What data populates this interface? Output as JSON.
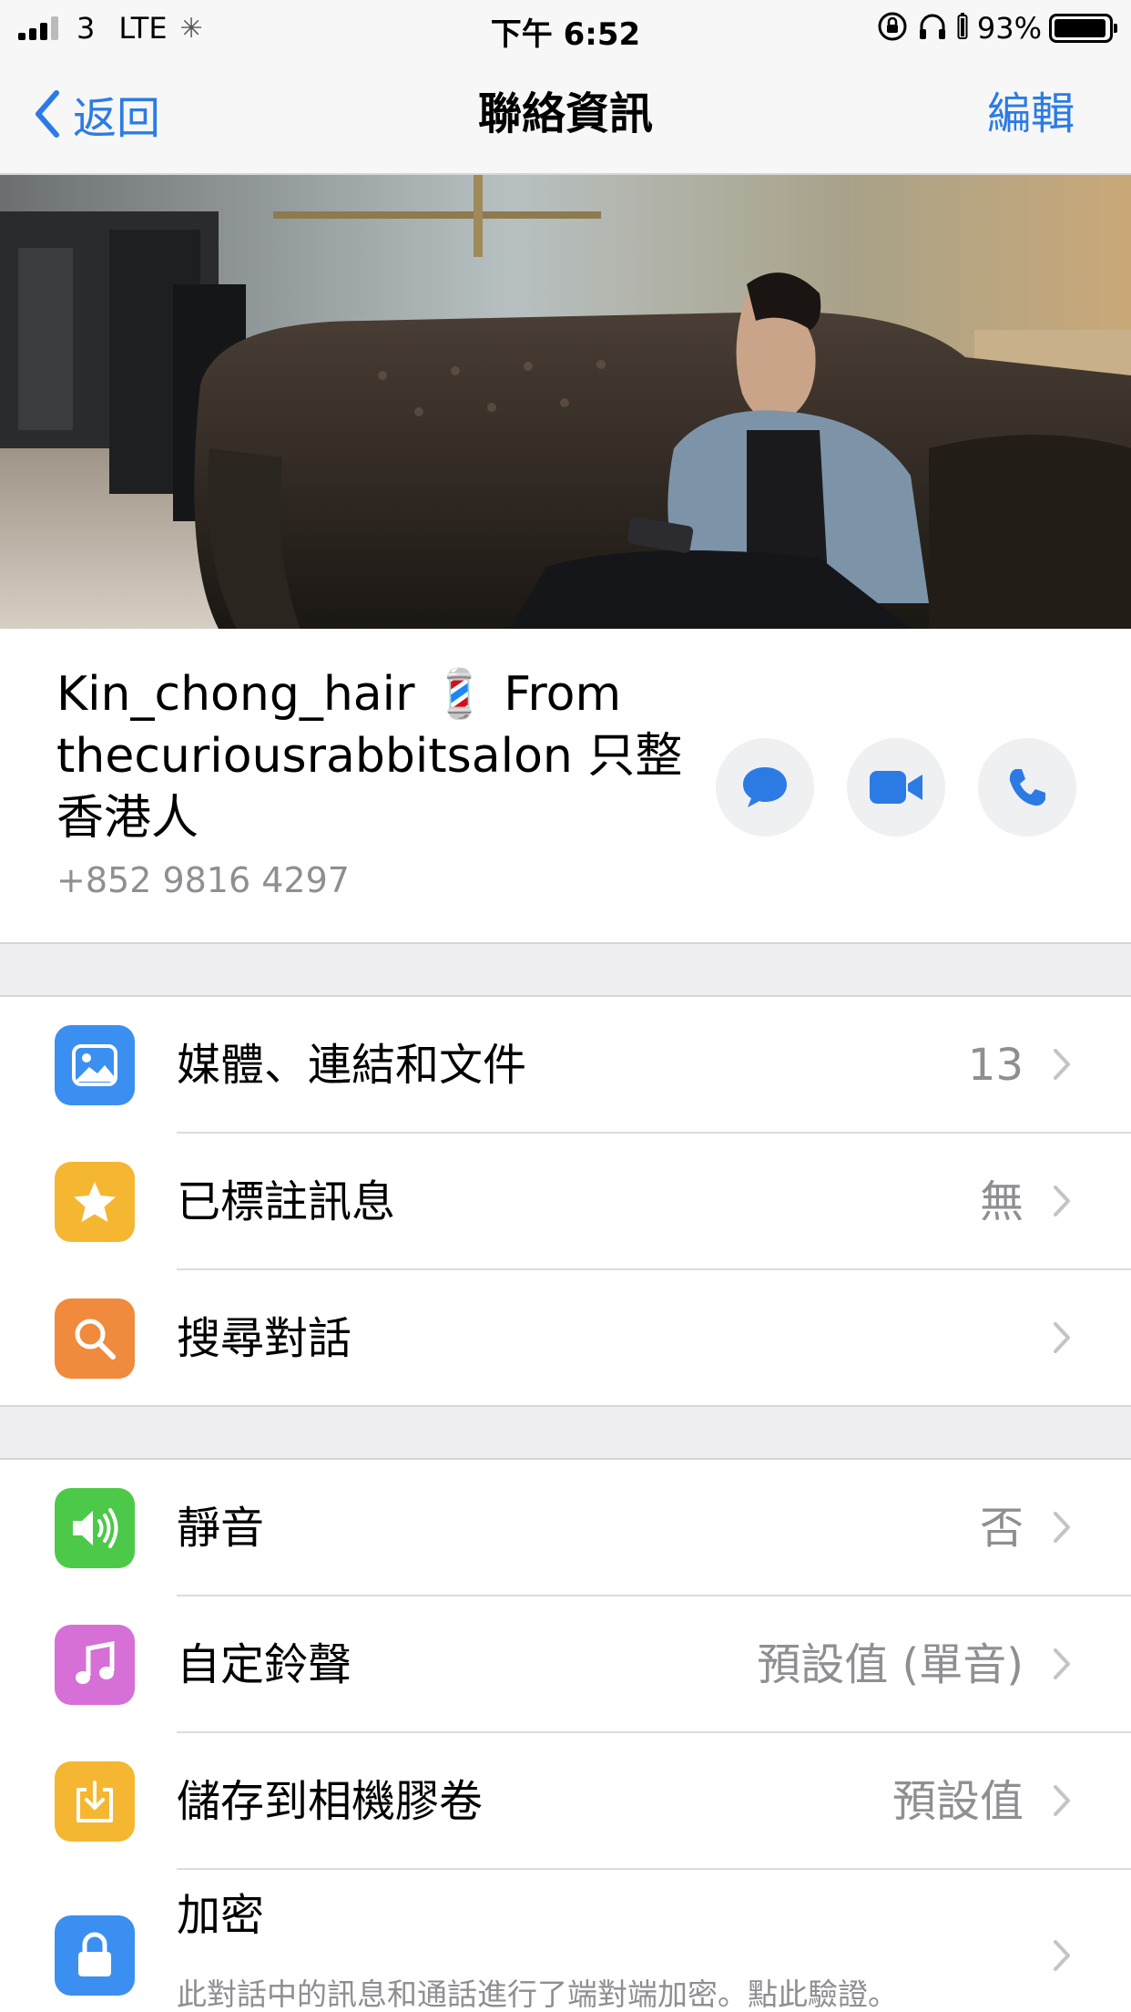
{
  "status_bar": {
    "carrier": "3",
    "network": "LTE",
    "time": "下午 6:52",
    "battery": "93%",
    "battery_level": 0.93
  },
  "nav": {
    "back_label": "返回",
    "title": "聯絡資訊",
    "edit_label": "編輯"
  },
  "profile": {
    "name": "Kin_chong_hair 💈 From thecuriousrabbitsalon 只整香港人",
    "phone": "+852 9816 4297",
    "actions": [
      "message-icon",
      "video-call-icon",
      "phone-icon"
    ]
  },
  "section1": [
    {
      "label": "媒體、連結和文件",
      "value": "13",
      "icon": "photo-icon",
      "color": "#3b8ff0"
    },
    {
      "label": "已標註訊息",
      "value": "無",
      "icon": "star-icon",
      "color": "#f5b731"
    },
    {
      "label": "搜尋對話",
      "value": "",
      "icon": "search-icon",
      "color": "#f08a3c"
    }
  ],
  "section2": [
    {
      "label": "靜音",
      "value": "否",
      "icon": "speaker-icon",
      "color": "#4dc94a"
    },
    {
      "label": "自定鈴聲",
      "value": "預設值 (單音)",
      "icon": "music-icon",
      "color": "#d66fd6"
    },
    {
      "label": "儲存到相機膠卷",
      "value": "預設值",
      "icon": "download-icon",
      "color": "#f5b731"
    },
    {
      "label": "加密",
      "value": "",
      "subtitle": "此對話中的訊息和通話進行了端對端加密。點此驗證。",
      "icon": "lock-icon",
      "color": "#3b8ff0"
    }
  ],
  "colors": {
    "accent": "#2c7be5",
    "secondary_text": "#8e8e93",
    "background_gap": "#eeeef0"
  }
}
